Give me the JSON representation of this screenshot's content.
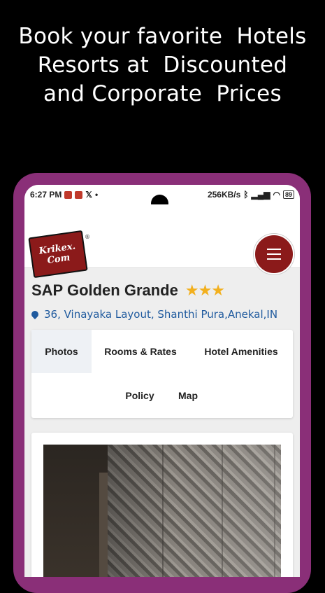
{
  "promo": {
    "line1": "Book your favorite  Hotels",
    "line2": "Resorts at  Discounted",
    "line3": "and Corporate  Prices"
  },
  "status_bar": {
    "time": "6:27 PM",
    "dot": "•",
    "network_speed": "256KB/s",
    "battery": "89"
  },
  "header": {
    "logo_line1": "Krikex.",
    "logo_line2": "Com",
    "registered": "®"
  },
  "hotel": {
    "name": "SAP Golden Grande",
    "stars": "★★★",
    "star_rating": 3,
    "address": "36, Vinayaka Layout, Shanthi Pura,Anekal,IN"
  },
  "tabs": {
    "photos": "Photos",
    "rooms_rates": "Rooms & Rates",
    "amenities": "Hotel Amenities",
    "policy": "Policy",
    "map": "Map",
    "active": "Photos"
  },
  "colors": {
    "brand": "#8b1a1a",
    "phone_frame": "#8a2f78",
    "link": "#1f5a9e",
    "star": "#f2b01e"
  }
}
